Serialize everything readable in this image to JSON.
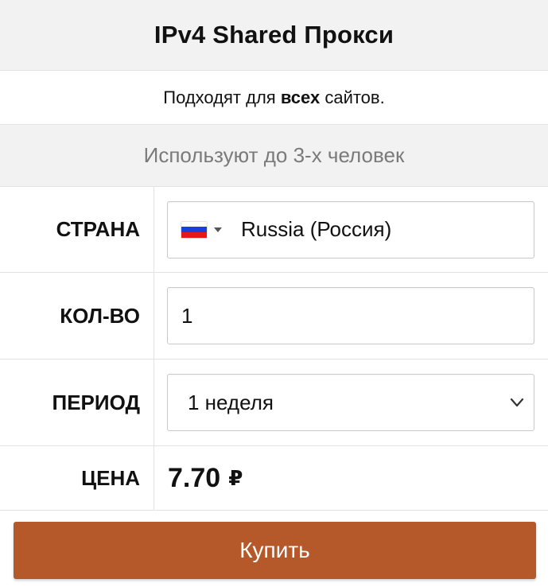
{
  "product": {
    "title": "IPv4 Shared Прокси",
    "feature_sites": {
      "prefix": "Подходят для ",
      "bold": "всех",
      "suffix": " сайтов."
    },
    "feature_users": "Используют до 3-х человек"
  },
  "form": {
    "country": {
      "label": "СТРАНА",
      "value": "Russia (Россия)",
      "flag_icon": "russia-flag-icon",
      "flag_colors": [
        "#ffffff",
        "#1c3fdc",
        "#e4181c"
      ]
    },
    "quantity": {
      "label": "КОЛ-ВО",
      "value": "1"
    },
    "period": {
      "label": "ПЕРИОД",
      "value": "1 неделя"
    },
    "price": {
      "label": "ЦЕНА",
      "amount": "7.70",
      "currency": "₽"
    }
  },
  "actions": {
    "buy_label": "Купить"
  },
  "colors": {
    "accent": "#b5592b",
    "row_gray": "#f2f2f2",
    "muted_text": "#7a7a7a"
  }
}
